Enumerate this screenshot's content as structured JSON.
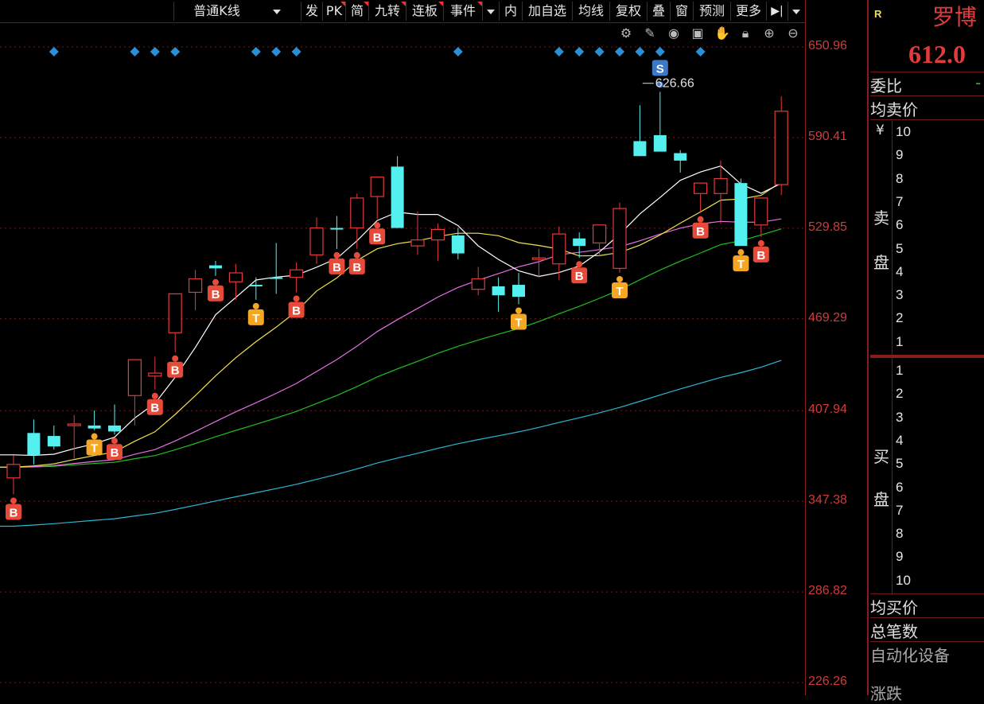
{
  "toolbar": {
    "items": [
      "普通K线",
      "发",
      "PK",
      "简",
      "九转",
      "连板",
      "事件",
      "内",
      "加自选",
      "均线",
      "复权",
      "叠",
      "窗",
      "预测",
      "更多"
    ]
  },
  "chart_icons": [
    "gear-icon",
    "pen-icon",
    "eye-icon",
    "box-icon",
    "hand-icon",
    "lock-icon",
    "zoom-in-icon",
    "zoom-out-icon"
  ],
  "chart_data": {
    "type": "candlestick",
    "y_ticks": [
      "650.96",
      "590.41",
      "529.85",
      "469.29",
      "407.94",
      "347.38",
      "286.82",
      "226.26"
    ],
    "ylim": [
      226.26,
      650.96
    ],
    "high_label": "626.66",
    "colors": {
      "up": "#e33b3b",
      "down": "#54f0f0",
      "ma5": "#ffffff",
      "ma10": "#f2e14c",
      "ma20": "#e66fe6",
      "ma30": "#1fbf1f",
      "ma60": "#2bb7d6"
    },
    "candles": [
      {
        "o": 363,
        "h": 378,
        "l": 352,
        "c": 372
      },
      {
        "o": 393,
        "h": 402,
        "l": 372,
        "c": 378
      },
      {
        "o": 391,
        "h": 398,
        "l": 382,
        "c": 384
      },
      {
        "o": 398,
        "h": 405,
        "l": 376,
        "c": 399
      },
      {
        "o": 398,
        "h": 408,
        "l": 395,
        "c": 396
      },
      {
        "o": 398,
        "h": 412,
        "l": 392,
        "c": 394
      },
      {
        "o": 418,
        "h": 441,
        "l": 398,
        "c": 442
      },
      {
        "o": 431,
        "h": 444,
        "l": 422,
        "c": 433
      },
      {
        "o": 460,
        "h": 477,
        "l": 447,
        "c": 486
      },
      {
        "o": 487,
        "h": 502,
        "l": 475,
        "c": 496
      },
      {
        "o": 505,
        "h": 508,
        "l": 498,
        "c": 503
      },
      {
        "o": 494,
        "h": 506,
        "l": 482,
        "c": 500
      },
      {
        "o": 492,
        "h": 497,
        "l": 482,
        "c": 491
      },
      {
        "o": 497,
        "h": 520,
        "l": 486,
        "c": 496
      },
      {
        "o": 497,
        "h": 507,
        "l": 487,
        "c": 502
      },
      {
        "o": 512,
        "h": 537,
        "l": 506,
        "c": 530
      },
      {
        "o": 530,
        "h": 538,
        "l": 516,
        "c": 529
      },
      {
        "o": 530,
        "h": 553,
        "l": 516,
        "c": 550
      },
      {
        "o": 551,
        "h": 559,
        "l": 536,
        "c": 564
      },
      {
        "o": 571,
        "h": 578,
        "l": 535,
        "c": 530
      },
      {
        "o": 518,
        "h": 541,
        "l": 512,
        "c": 522
      },
      {
        "o": 522,
        "h": 533,
        "l": 508,
        "c": 529
      },
      {
        "o": 525,
        "h": 530,
        "l": 509,
        "c": 513
      },
      {
        "o": 489,
        "h": 504,
        "l": 485,
        "c": 496
      },
      {
        "o": 491,
        "h": 497,
        "l": 474,
        "c": 485
      },
      {
        "o": 492,
        "h": 500,
        "l": 479,
        "c": 484
      },
      {
        "o": 509,
        "h": 516,
        "l": 497,
        "c": 510
      },
      {
        "o": 506,
        "h": 531,
        "l": 495,
        "c": 526
      },
      {
        "o": 523,
        "h": 527,
        "l": 510,
        "c": 518
      },
      {
        "o": 520,
        "h": 528,
        "l": 511,
        "c": 532
      },
      {
        "o": 503,
        "h": 547,
        "l": 500,
        "c": 543
      },
      {
        "o": 588,
        "h": 612,
        "l": 581,
        "c": 578
      },
      {
        "o": 592,
        "h": 621,
        "l": 585,
        "c": 581
      },
      {
        "o": 580,
        "h": 582,
        "l": 567,
        "c": 575
      },
      {
        "o": 553,
        "h": 557,
        "l": 540,
        "c": 560
      },
      {
        "o": 553,
        "h": 575,
        "l": 533,
        "c": 563
      },
      {
        "o": 560,
        "h": 563,
        "l": 524,
        "c": 518
      },
      {
        "o": 532,
        "h": 547,
        "l": 524,
        "c": 550
      },
      {
        "o": 559,
        "h": 618,
        "l": 552,
        "c": 608
      }
    ],
    "signals": [
      {
        "type": "B",
        "i": 0
      },
      {
        "type": "T",
        "i": 4
      },
      {
        "type": "B",
        "i": 5
      },
      {
        "type": "B",
        "i": 7
      },
      {
        "type": "B",
        "i": 8
      },
      {
        "type": "B",
        "i": 10
      },
      {
        "type": "T",
        "i": 12
      },
      {
        "type": "B",
        "i": 14
      },
      {
        "type": "B",
        "i": 16
      },
      {
        "type": "B",
        "i": 17
      },
      {
        "type": "B",
        "i": 18
      },
      {
        "type": "T",
        "i": 25
      },
      {
        "type": "B",
        "i": 28
      },
      {
        "type": "T",
        "i": 30
      },
      {
        "type": "S",
        "i": 32
      },
      {
        "type": "B",
        "i": 34
      },
      {
        "type": "T",
        "i": 36
      },
      {
        "type": "B",
        "i": 37
      }
    ],
    "top_markers": [
      2,
      6,
      7,
      8,
      12,
      13,
      14,
      22,
      27,
      28,
      29,
      30,
      31,
      32,
      34
    ]
  },
  "panel": {
    "mark": "R",
    "name": "罗博",
    "price": "612.0",
    "weibi": "委比",
    "weibi_value": "-",
    "avg_sell": "均卖价",
    "yen": "¥",
    "sell_label_1": "卖",
    "sell_label_2": "盘",
    "sell_levels": [
      "10",
      "9",
      "8",
      "7",
      "6",
      "5",
      "4",
      "3",
      "2",
      "1"
    ],
    "buy_levels": [
      "1",
      "2",
      "3",
      "4",
      "5",
      "6",
      "7",
      "8",
      "9",
      "10"
    ],
    "buy_label_1": "买",
    "buy_label_2": "盘",
    "avg_buy": "均买价",
    "total_trades": "总笔数",
    "partial_1": "自动化设备",
    "partial_2": "涨跌"
  }
}
